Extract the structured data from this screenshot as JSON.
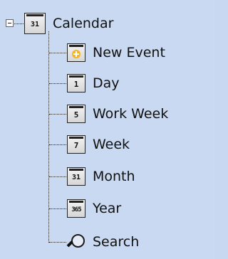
{
  "tree": {
    "root": {
      "label": "Calendar",
      "icon": "calendar-month-icon",
      "icon_text": "31"
    },
    "items": [
      {
        "label": "New Event",
        "icon": "new-event-icon",
        "icon_text": ""
      },
      {
        "label": "Day",
        "icon": "calendar-day-icon",
        "icon_text": "1"
      },
      {
        "label": "Work Week",
        "icon": "calendar-work-week-icon",
        "icon_text": "5"
      },
      {
        "label": "Week",
        "icon": "calendar-week-icon",
        "icon_text": "7"
      },
      {
        "label": "Month",
        "icon": "calendar-month-icon",
        "icon_text": "31"
      },
      {
        "label": "Year",
        "icon": "calendar-year-icon",
        "icon_text": "365"
      },
      {
        "label": "Search",
        "icon": "search-icon",
        "icon_text": ""
      }
    ]
  },
  "colors": {
    "background": "#c9d9f1",
    "icon_border": "#222222",
    "new_event_accent": "#f3b52a"
  }
}
